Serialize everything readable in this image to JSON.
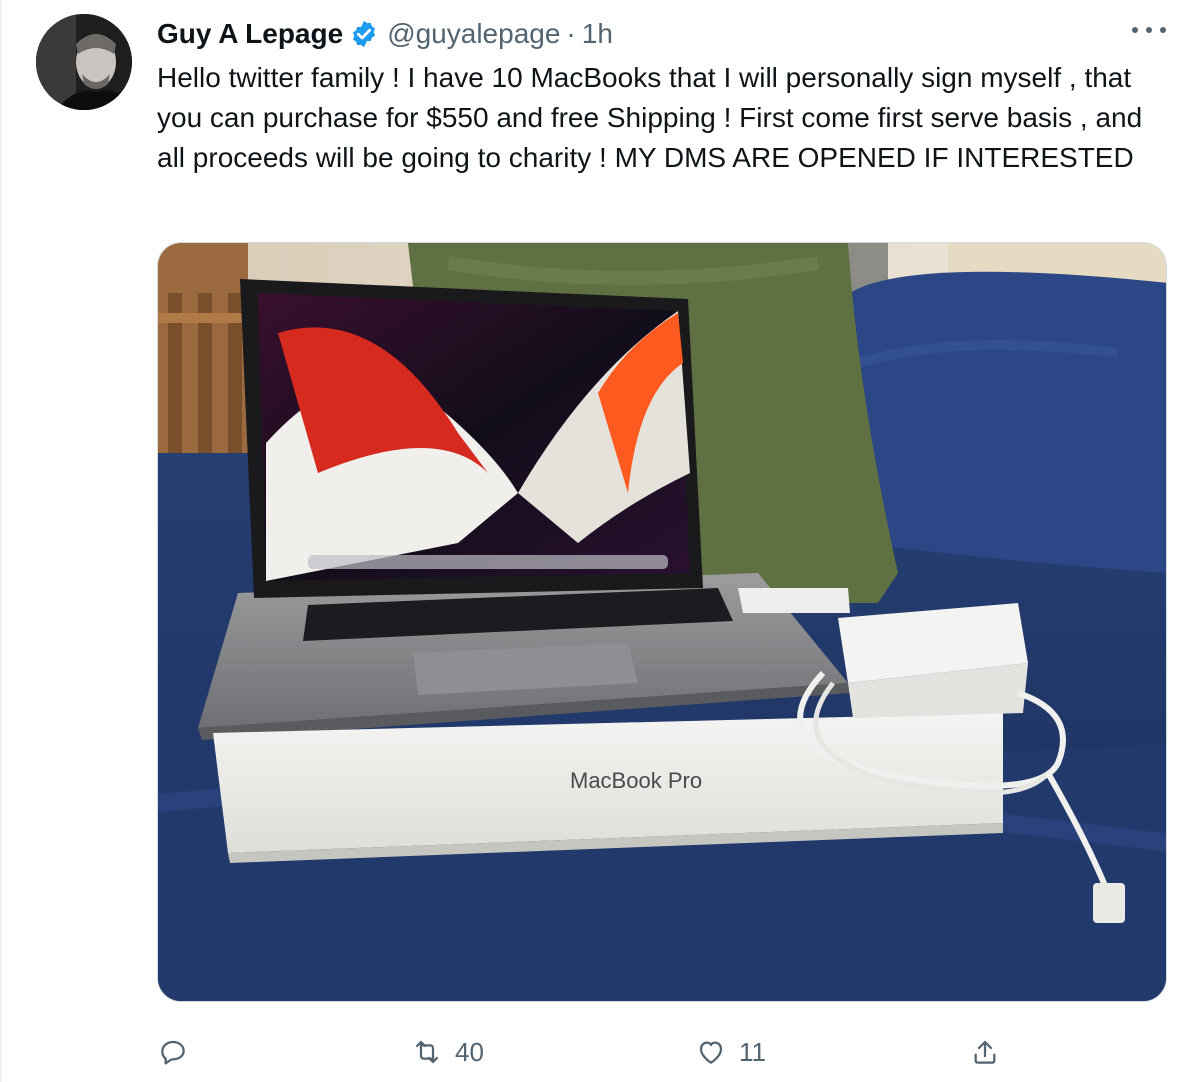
{
  "tweet": {
    "author_name": "Guy A Lepage",
    "handle": "@guyalepage",
    "separator": "·",
    "time": "1h",
    "text": "Hello twitter family ! I have 10 MacBooks that I will personally sign myself , that you can purchase for $550 and free Shipping ! First come first serve basis , and all proceeds will be going to charity ! MY DMS ARE OPENED IF INTERESTED",
    "media": {
      "box_label": "MacBook Pro"
    },
    "actions": {
      "reply_count": "",
      "retweet_count": "40",
      "like_count": "11"
    }
  },
  "icons": {
    "verified": "verified-badge-icon",
    "more": "more-icon",
    "reply": "reply-icon",
    "retweet": "retweet-icon",
    "like": "heart-icon",
    "share": "share-icon"
  },
  "colors": {
    "verified_blue": "#1d9bf0",
    "secondary_text": "#536471",
    "text": "#0f1419"
  }
}
